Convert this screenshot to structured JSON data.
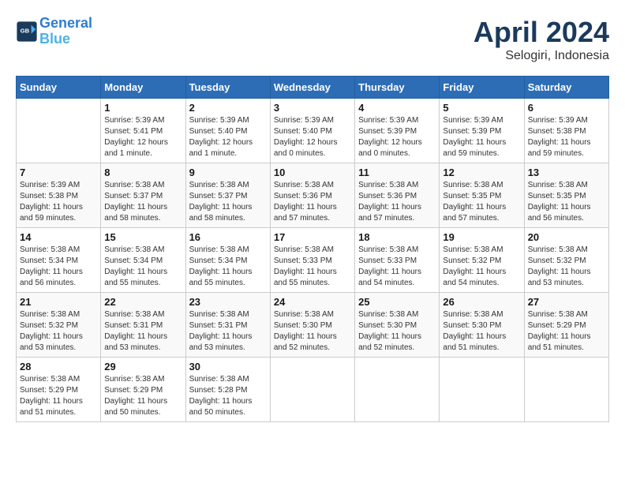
{
  "header": {
    "logo_line1": "General",
    "logo_line2": "Blue",
    "month": "April 2024",
    "location": "Selogiri, Indonesia"
  },
  "weekdays": [
    "Sunday",
    "Monday",
    "Tuesday",
    "Wednesday",
    "Thursday",
    "Friday",
    "Saturday"
  ],
  "weeks": [
    [
      {
        "day": "",
        "sunrise": "",
        "sunset": "",
        "daylight": ""
      },
      {
        "day": "1",
        "sunrise": "Sunrise: 5:39 AM",
        "sunset": "Sunset: 5:41 PM",
        "daylight": "Daylight: 12 hours and 1 minute."
      },
      {
        "day": "2",
        "sunrise": "Sunrise: 5:39 AM",
        "sunset": "Sunset: 5:40 PM",
        "daylight": "Daylight: 12 hours and 1 minute."
      },
      {
        "day": "3",
        "sunrise": "Sunrise: 5:39 AM",
        "sunset": "Sunset: 5:40 PM",
        "daylight": "Daylight: 12 hours and 0 minutes."
      },
      {
        "day": "4",
        "sunrise": "Sunrise: 5:39 AM",
        "sunset": "Sunset: 5:39 PM",
        "daylight": "Daylight: 12 hours and 0 minutes."
      },
      {
        "day": "5",
        "sunrise": "Sunrise: 5:39 AM",
        "sunset": "Sunset: 5:39 PM",
        "daylight": "Daylight: 11 hours and 59 minutes."
      },
      {
        "day": "6",
        "sunrise": "Sunrise: 5:39 AM",
        "sunset": "Sunset: 5:38 PM",
        "daylight": "Daylight: 11 hours and 59 minutes."
      }
    ],
    [
      {
        "day": "7",
        "sunrise": "Sunrise: 5:39 AM",
        "sunset": "Sunset: 5:38 PM",
        "daylight": "Daylight: 11 hours and 59 minutes."
      },
      {
        "day": "8",
        "sunrise": "Sunrise: 5:38 AM",
        "sunset": "Sunset: 5:37 PM",
        "daylight": "Daylight: 11 hours and 58 minutes."
      },
      {
        "day": "9",
        "sunrise": "Sunrise: 5:38 AM",
        "sunset": "Sunset: 5:37 PM",
        "daylight": "Daylight: 11 hours and 58 minutes."
      },
      {
        "day": "10",
        "sunrise": "Sunrise: 5:38 AM",
        "sunset": "Sunset: 5:36 PM",
        "daylight": "Daylight: 11 hours and 57 minutes."
      },
      {
        "day": "11",
        "sunrise": "Sunrise: 5:38 AM",
        "sunset": "Sunset: 5:36 PM",
        "daylight": "Daylight: 11 hours and 57 minutes."
      },
      {
        "day": "12",
        "sunrise": "Sunrise: 5:38 AM",
        "sunset": "Sunset: 5:35 PM",
        "daylight": "Daylight: 11 hours and 57 minutes."
      },
      {
        "day": "13",
        "sunrise": "Sunrise: 5:38 AM",
        "sunset": "Sunset: 5:35 PM",
        "daylight": "Daylight: 11 hours and 56 minutes."
      }
    ],
    [
      {
        "day": "14",
        "sunrise": "Sunrise: 5:38 AM",
        "sunset": "Sunset: 5:34 PM",
        "daylight": "Daylight: 11 hours and 56 minutes."
      },
      {
        "day": "15",
        "sunrise": "Sunrise: 5:38 AM",
        "sunset": "Sunset: 5:34 PM",
        "daylight": "Daylight: 11 hours and 55 minutes."
      },
      {
        "day": "16",
        "sunrise": "Sunrise: 5:38 AM",
        "sunset": "Sunset: 5:34 PM",
        "daylight": "Daylight: 11 hours and 55 minutes."
      },
      {
        "day": "17",
        "sunrise": "Sunrise: 5:38 AM",
        "sunset": "Sunset: 5:33 PM",
        "daylight": "Daylight: 11 hours and 55 minutes."
      },
      {
        "day": "18",
        "sunrise": "Sunrise: 5:38 AM",
        "sunset": "Sunset: 5:33 PM",
        "daylight": "Daylight: 11 hours and 54 minutes."
      },
      {
        "day": "19",
        "sunrise": "Sunrise: 5:38 AM",
        "sunset": "Sunset: 5:32 PM",
        "daylight": "Daylight: 11 hours and 54 minutes."
      },
      {
        "day": "20",
        "sunrise": "Sunrise: 5:38 AM",
        "sunset": "Sunset: 5:32 PM",
        "daylight": "Daylight: 11 hours and 53 minutes."
      }
    ],
    [
      {
        "day": "21",
        "sunrise": "Sunrise: 5:38 AM",
        "sunset": "Sunset: 5:32 PM",
        "daylight": "Daylight: 11 hours and 53 minutes."
      },
      {
        "day": "22",
        "sunrise": "Sunrise: 5:38 AM",
        "sunset": "Sunset: 5:31 PM",
        "daylight": "Daylight: 11 hours and 53 minutes."
      },
      {
        "day": "23",
        "sunrise": "Sunrise: 5:38 AM",
        "sunset": "Sunset: 5:31 PM",
        "daylight": "Daylight: 11 hours and 53 minutes."
      },
      {
        "day": "24",
        "sunrise": "Sunrise: 5:38 AM",
        "sunset": "Sunset: 5:30 PM",
        "daylight": "Daylight: 11 hours and 52 minutes."
      },
      {
        "day": "25",
        "sunrise": "Sunrise: 5:38 AM",
        "sunset": "Sunset: 5:30 PM",
        "daylight": "Daylight: 11 hours and 52 minutes."
      },
      {
        "day": "26",
        "sunrise": "Sunrise: 5:38 AM",
        "sunset": "Sunset: 5:30 PM",
        "daylight": "Daylight: 11 hours and 51 minutes."
      },
      {
        "day": "27",
        "sunrise": "Sunrise: 5:38 AM",
        "sunset": "Sunset: 5:29 PM",
        "daylight": "Daylight: 11 hours and 51 minutes."
      }
    ],
    [
      {
        "day": "28",
        "sunrise": "Sunrise: 5:38 AM",
        "sunset": "Sunset: 5:29 PM",
        "daylight": "Daylight: 11 hours and 51 minutes."
      },
      {
        "day": "29",
        "sunrise": "Sunrise: 5:38 AM",
        "sunset": "Sunset: 5:29 PM",
        "daylight": "Daylight: 11 hours and 50 minutes."
      },
      {
        "day": "30",
        "sunrise": "Sunrise: 5:38 AM",
        "sunset": "Sunset: 5:28 PM",
        "daylight": "Daylight: 11 hours and 50 minutes."
      },
      {
        "day": "",
        "sunrise": "",
        "sunset": "",
        "daylight": ""
      },
      {
        "day": "",
        "sunrise": "",
        "sunset": "",
        "daylight": ""
      },
      {
        "day": "",
        "sunrise": "",
        "sunset": "",
        "daylight": ""
      },
      {
        "day": "",
        "sunrise": "",
        "sunset": "",
        "daylight": ""
      }
    ]
  ]
}
